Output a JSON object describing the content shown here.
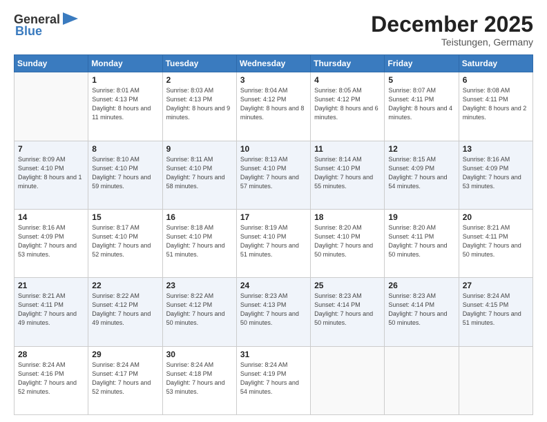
{
  "logo": {
    "line1": "General",
    "line2": "Blue",
    "icon": "▶"
  },
  "header": {
    "month": "December 2025",
    "location": "Teistungen, Germany"
  },
  "weekdays": [
    "Sunday",
    "Monday",
    "Tuesday",
    "Wednesday",
    "Thursday",
    "Friday",
    "Saturday"
  ],
  "weeks": [
    [
      {
        "day": "",
        "sunrise": "",
        "sunset": "",
        "daylight": ""
      },
      {
        "day": "1",
        "sunrise": "Sunrise: 8:01 AM",
        "sunset": "Sunset: 4:13 PM",
        "daylight": "Daylight: 8 hours and 11 minutes."
      },
      {
        "day": "2",
        "sunrise": "Sunrise: 8:03 AM",
        "sunset": "Sunset: 4:13 PM",
        "daylight": "Daylight: 8 hours and 9 minutes."
      },
      {
        "day": "3",
        "sunrise": "Sunrise: 8:04 AM",
        "sunset": "Sunset: 4:12 PM",
        "daylight": "Daylight: 8 hours and 8 minutes."
      },
      {
        "day": "4",
        "sunrise": "Sunrise: 8:05 AM",
        "sunset": "Sunset: 4:12 PM",
        "daylight": "Daylight: 8 hours and 6 minutes."
      },
      {
        "day": "5",
        "sunrise": "Sunrise: 8:07 AM",
        "sunset": "Sunset: 4:11 PM",
        "daylight": "Daylight: 8 hours and 4 minutes."
      },
      {
        "day": "6",
        "sunrise": "Sunrise: 8:08 AM",
        "sunset": "Sunset: 4:11 PM",
        "daylight": "Daylight: 8 hours and 2 minutes."
      }
    ],
    [
      {
        "day": "7",
        "sunrise": "Sunrise: 8:09 AM",
        "sunset": "Sunset: 4:10 PM",
        "daylight": "Daylight: 8 hours and 1 minute."
      },
      {
        "day": "8",
        "sunrise": "Sunrise: 8:10 AM",
        "sunset": "Sunset: 4:10 PM",
        "daylight": "Daylight: 7 hours and 59 minutes."
      },
      {
        "day": "9",
        "sunrise": "Sunrise: 8:11 AM",
        "sunset": "Sunset: 4:10 PM",
        "daylight": "Daylight: 7 hours and 58 minutes."
      },
      {
        "day": "10",
        "sunrise": "Sunrise: 8:13 AM",
        "sunset": "Sunset: 4:10 PM",
        "daylight": "Daylight: 7 hours and 57 minutes."
      },
      {
        "day": "11",
        "sunrise": "Sunrise: 8:14 AM",
        "sunset": "Sunset: 4:10 PM",
        "daylight": "Daylight: 7 hours and 55 minutes."
      },
      {
        "day": "12",
        "sunrise": "Sunrise: 8:15 AM",
        "sunset": "Sunset: 4:09 PM",
        "daylight": "Daylight: 7 hours and 54 minutes."
      },
      {
        "day": "13",
        "sunrise": "Sunrise: 8:16 AM",
        "sunset": "Sunset: 4:09 PM",
        "daylight": "Daylight: 7 hours and 53 minutes."
      }
    ],
    [
      {
        "day": "14",
        "sunrise": "Sunrise: 8:16 AM",
        "sunset": "Sunset: 4:09 PM",
        "daylight": "Daylight: 7 hours and 53 minutes."
      },
      {
        "day": "15",
        "sunrise": "Sunrise: 8:17 AM",
        "sunset": "Sunset: 4:10 PM",
        "daylight": "Daylight: 7 hours and 52 minutes."
      },
      {
        "day": "16",
        "sunrise": "Sunrise: 8:18 AM",
        "sunset": "Sunset: 4:10 PM",
        "daylight": "Daylight: 7 hours and 51 minutes."
      },
      {
        "day": "17",
        "sunrise": "Sunrise: 8:19 AM",
        "sunset": "Sunset: 4:10 PM",
        "daylight": "Daylight: 7 hours and 51 minutes."
      },
      {
        "day": "18",
        "sunrise": "Sunrise: 8:20 AM",
        "sunset": "Sunset: 4:10 PM",
        "daylight": "Daylight: 7 hours and 50 minutes."
      },
      {
        "day": "19",
        "sunrise": "Sunrise: 8:20 AM",
        "sunset": "Sunset: 4:11 PM",
        "daylight": "Daylight: 7 hours and 50 minutes."
      },
      {
        "day": "20",
        "sunrise": "Sunrise: 8:21 AM",
        "sunset": "Sunset: 4:11 PM",
        "daylight": "Daylight: 7 hours and 50 minutes."
      }
    ],
    [
      {
        "day": "21",
        "sunrise": "Sunrise: 8:21 AM",
        "sunset": "Sunset: 4:11 PM",
        "daylight": "Daylight: 7 hours and 49 minutes."
      },
      {
        "day": "22",
        "sunrise": "Sunrise: 8:22 AM",
        "sunset": "Sunset: 4:12 PM",
        "daylight": "Daylight: 7 hours and 49 minutes."
      },
      {
        "day": "23",
        "sunrise": "Sunrise: 8:22 AM",
        "sunset": "Sunset: 4:12 PM",
        "daylight": "Daylight: 7 hours and 50 minutes."
      },
      {
        "day": "24",
        "sunrise": "Sunrise: 8:23 AM",
        "sunset": "Sunset: 4:13 PM",
        "daylight": "Daylight: 7 hours and 50 minutes."
      },
      {
        "day": "25",
        "sunrise": "Sunrise: 8:23 AM",
        "sunset": "Sunset: 4:14 PM",
        "daylight": "Daylight: 7 hours and 50 minutes."
      },
      {
        "day": "26",
        "sunrise": "Sunrise: 8:23 AM",
        "sunset": "Sunset: 4:14 PM",
        "daylight": "Daylight: 7 hours and 50 minutes."
      },
      {
        "day": "27",
        "sunrise": "Sunrise: 8:24 AM",
        "sunset": "Sunset: 4:15 PM",
        "daylight": "Daylight: 7 hours and 51 minutes."
      }
    ],
    [
      {
        "day": "28",
        "sunrise": "Sunrise: 8:24 AM",
        "sunset": "Sunset: 4:16 PM",
        "daylight": "Daylight: 7 hours and 52 minutes."
      },
      {
        "day": "29",
        "sunrise": "Sunrise: 8:24 AM",
        "sunset": "Sunset: 4:17 PM",
        "daylight": "Daylight: 7 hours and 52 minutes."
      },
      {
        "day": "30",
        "sunrise": "Sunrise: 8:24 AM",
        "sunset": "Sunset: 4:18 PM",
        "daylight": "Daylight: 7 hours and 53 minutes."
      },
      {
        "day": "31",
        "sunrise": "Sunrise: 8:24 AM",
        "sunset": "Sunset: 4:19 PM",
        "daylight": "Daylight: 7 hours and 54 minutes."
      },
      {
        "day": "",
        "sunrise": "",
        "sunset": "",
        "daylight": ""
      },
      {
        "day": "",
        "sunrise": "",
        "sunset": "",
        "daylight": ""
      },
      {
        "day": "",
        "sunrise": "",
        "sunset": "",
        "daylight": ""
      }
    ]
  ]
}
